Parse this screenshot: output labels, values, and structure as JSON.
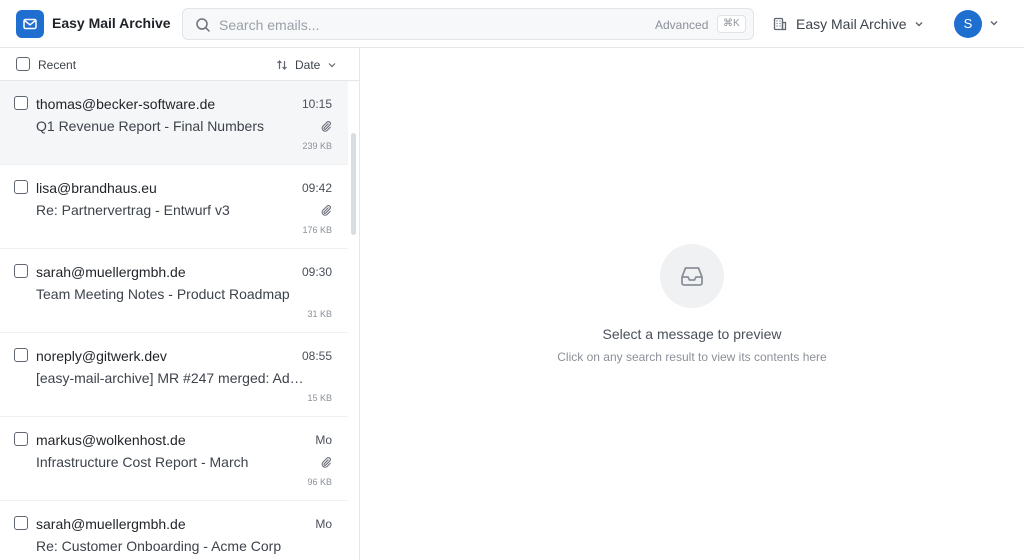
{
  "app": {
    "title": "Easy Mail Archive"
  },
  "search": {
    "placeholder": "Search emails...",
    "value": "",
    "advanced_label": "Advanced",
    "shortcut": "⌘K"
  },
  "account": {
    "name": "Easy Mail Archive",
    "avatar_initial": "S"
  },
  "list": {
    "select_all_label": "Recent",
    "sort_label": "Date",
    "rows": [
      {
        "sender": "thomas@becker-software.de",
        "time": "10:15",
        "subject": "Q1 Revenue Report - Final Numbers",
        "size": "239 KB",
        "attachment": true,
        "selected": true
      },
      {
        "sender": "lisa@brandhaus.eu",
        "time": "09:42",
        "subject": "Re: Partnervertrag - Entwurf v3",
        "size": "176 KB",
        "attachment": true,
        "selected": false
      },
      {
        "sender": "sarah@muellergmbh.de",
        "time": "09:30",
        "subject": "Team Meeting Notes - Product Roadmap",
        "size": "31 KB",
        "attachment": false,
        "selected": false
      },
      {
        "sender": "noreply@gitwerk.dev",
        "time": "08:55",
        "subject": "[easy-mail-archive] MR #247 merged: Add …",
        "size": "15 KB",
        "attachment": false,
        "selected": false
      },
      {
        "sender": "markus@wolkenhost.de",
        "time": "Mo",
        "subject": "Infrastructure Cost Report - March",
        "size": "96 KB",
        "attachment": true,
        "selected": false
      },
      {
        "sender": "sarah@muellergmbh.de",
        "time": "Mo",
        "subject": "Re: Customer Onboarding - Acme Corp",
        "size": "",
        "attachment": false,
        "selected": false
      }
    ]
  },
  "preview": {
    "empty_title": "Select a message to preview",
    "empty_subtitle": "Click on any search result to view its contents here"
  },
  "colors": {
    "accent": "#1f6fd1",
    "selected_row": "#f5f6f8",
    "border": "#e5e7eb"
  },
  "icons": {
    "logo": "mail-icon",
    "search": "search-icon",
    "account": "building-icon",
    "caret": "chevron-down-icon",
    "sort": "sort-arrows-icon",
    "attachment": "paperclip-icon",
    "empty": "inbox-icon"
  }
}
